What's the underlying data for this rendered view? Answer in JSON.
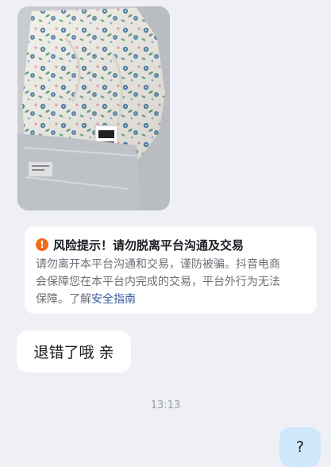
{
  "messages": {
    "photo": {
      "description_icon": "product-photo"
    },
    "risk_notice": {
      "icon": "warning-icon",
      "icon_glyph": "!",
      "title": "风险提示！请勿脱离平台沟通及交易",
      "body_line1": "请勿离开本平台沟通和交易，谨防被骗。抖音电商",
      "body_line2": "会保障您在本平台内完成的交易，平台外行为无法",
      "body_prefix3": "保障。了解",
      "link_text": "安全指南"
    },
    "incoming_text": "退错了哦 亲",
    "timestamp": "13:13",
    "outgoing_text": "?"
  },
  "colors": {
    "background": "#eef0f5",
    "warning": "#f26a1b",
    "link": "#3a5b9e",
    "outgoing_bubble": "#cfe7fa"
  }
}
